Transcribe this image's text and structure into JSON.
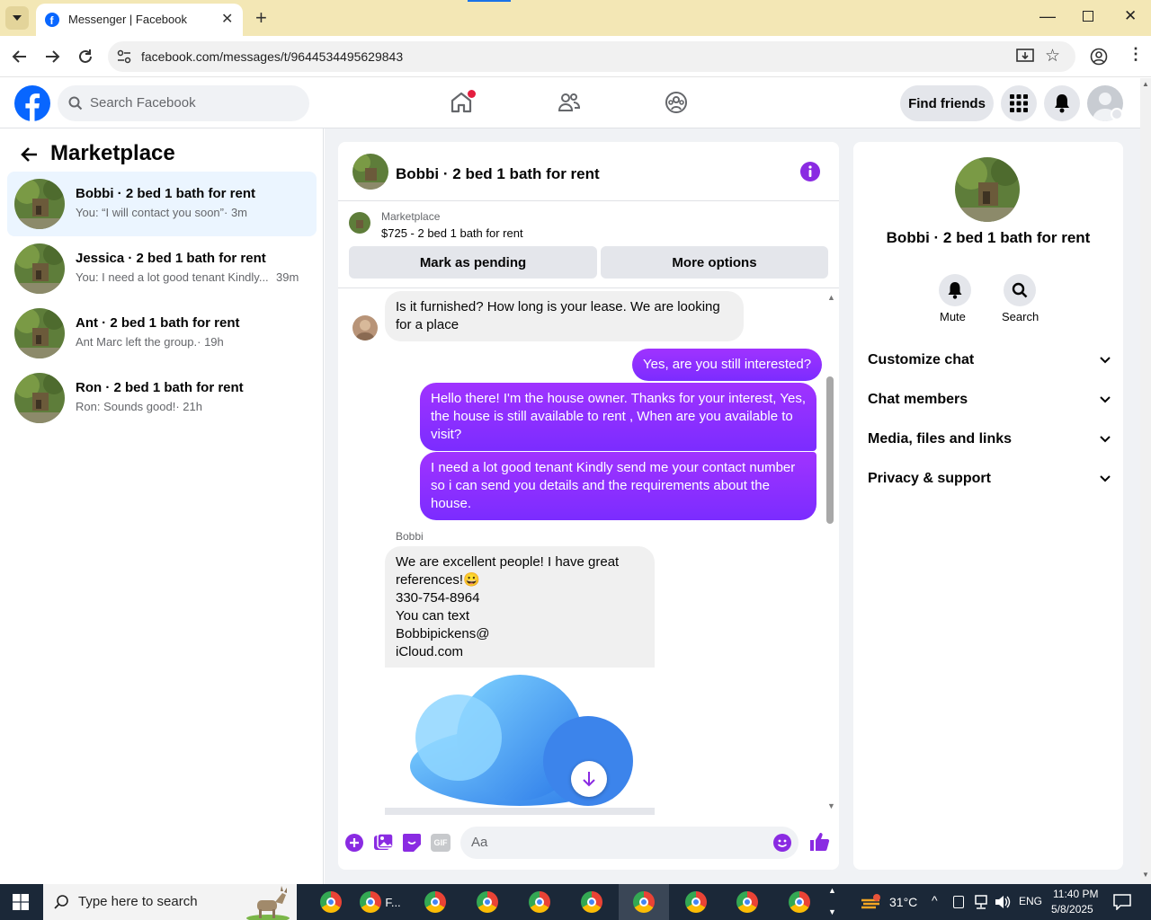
{
  "browser": {
    "tab_title": "Messenger | Facebook",
    "url": "facebook.com/messages/t/9644534495629843"
  },
  "fb_header": {
    "search_placeholder": "Search Facebook",
    "find_friends": "Find friends"
  },
  "left_panel": {
    "title": "Marketplace",
    "conversations": [
      {
        "name": "Bobbi · 2 bed 1 bath for rent",
        "snippet": "You: “I will contact you soon”",
        "time": "· 3m",
        "active": true
      },
      {
        "name": "Jessica · 2 bed 1 bath for rent",
        "snippet": "You: I need a lot good tenant Kindly...",
        "time": "39m",
        "active": false
      },
      {
        "name": "Ant · 2 bed 1 bath for rent",
        "snippet": "Ant Marc left the group.",
        "time": "· 19h",
        "active": false
      },
      {
        "name": "Ron · 2 bed 1 bath for rent",
        "snippet": "Ron: Sounds good!",
        "time": "· 21h",
        "active": false
      }
    ]
  },
  "chat": {
    "title": "Bobbi · 2 bed 1 bath for rent",
    "listing_label": "Marketplace",
    "listing_price_title": "$725 - 2 bed 1 bath for rent",
    "mark_pending": "Mark as pending",
    "more_options": "More options",
    "messages": [
      {
        "dir": "in",
        "text": "Is it furnished? How long is your lease. We are looking for a place"
      },
      {
        "dir": "out",
        "text": "Yes, are you still interested?"
      },
      {
        "dir": "out",
        "text": "Hello there! I'm the house owner. Thanks for your interest, Yes, the house is still available to rent , When are you available to visit?"
      },
      {
        "dir": "out",
        "text": "I need a lot good tenant Kindly send me your contact number so i can send you details and the requirements about the house."
      },
      {
        "dir": "in",
        "sender": "Bobbi",
        "lines": [
          "We are excellent people! I have great",
          "references!😀",
          "330-754-8964",
          "You can text",
          "Bobbipickens@",
          "iCloud.com"
        ]
      }
    ],
    "composer_placeholder": "Aa",
    "composer_gif": "GIF"
  },
  "right_panel": {
    "name": "Bobbi · 2 bed 1 bath for rent",
    "mute": "Mute",
    "search": "Search",
    "sections": [
      "Customize chat",
      "Chat members",
      "Media, files and links",
      "Privacy & support"
    ]
  },
  "taskbar": {
    "search_placeholder": "Type here to search",
    "app_label": "F...",
    "temperature": "31°C",
    "language": "ENG",
    "time": "11:40 PM",
    "date": "5/8/2025"
  },
  "colors": {
    "accent_purple": "#8a2be2",
    "fb_blue": "#0866ff",
    "active_conv_bg": "#ebf5ff"
  }
}
